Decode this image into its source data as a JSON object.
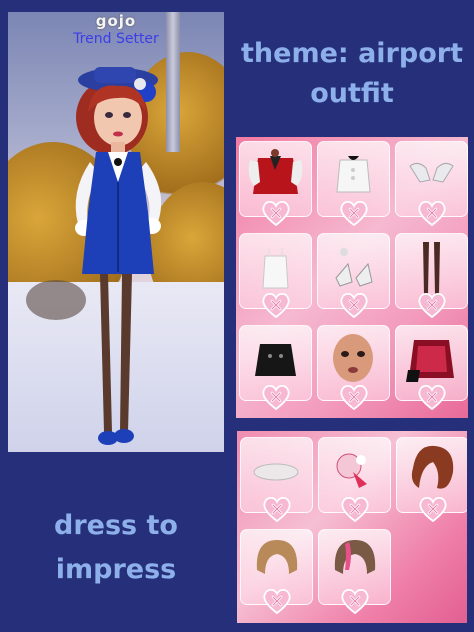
{
  "player": {
    "name": "gojo",
    "title": "Trend Setter"
  },
  "theme_text": [
    "theme: airport",
    "outfit"
  ],
  "footer_text": [
    "dress to",
    "impress"
  ],
  "colors": {
    "background": "#26307a",
    "text_accent": "#8eb0ea",
    "title_blue": "#3b3dea",
    "panel_pink": "#f39bbc"
  },
  "panels": {
    "top_items": [
      "red-vest-jacket",
      "white-ruffle-blouse",
      "white-gloves",
      "white-corset-top",
      "white-platform-heels",
      "brown-tights",
      "black-skirt",
      "face-makeup",
      "red-leather-jacket"
    ],
    "bottom_items": [
      "white-beret",
      "pink-bow-fascinator",
      "auburn-wavy-hair",
      "blonde-bob-hair",
      "pink-streak-hair"
    ],
    "favorite_icon": "heart-with-x-icon"
  }
}
